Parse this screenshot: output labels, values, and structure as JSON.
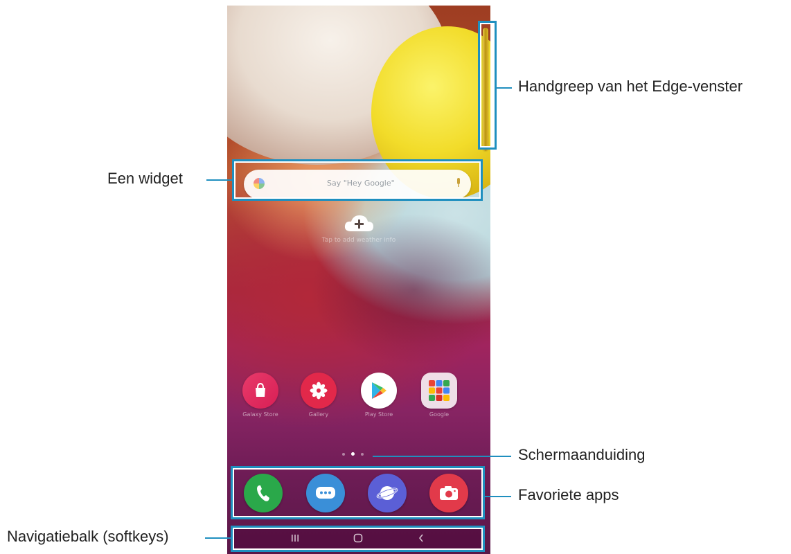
{
  "callouts": {
    "edge_handle": "Handgreep van het Edge-venster",
    "widget": "Een widget",
    "screen_indicator": "Schermaanduiding",
    "favorite_apps": "Favoriete apps",
    "navigation_bar": "Navigatiebalk (softkeys)"
  },
  "screen": {
    "weather_label": "Tap to add weather info",
    "search_placeholder": "Say \"Hey Google\"",
    "apps": [
      {
        "label": "Galaxy Store",
        "icon": "galaxy-store-icon"
      },
      {
        "label": "Gallery",
        "icon": "gallery-icon"
      },
      {
        "label": "Play Store",
        "icon": "play-store-icon"
      },
      {
        "label": "Google",
        "icon": "google-folder-icon"
      }
    ],
    "dock": [
      {
        "icon": "phone-icon"
      },
      {
        "icon": "messages-icon"
      },
      {
        "icon": "internet-icon"
      },
      {
        "icon": "camera-icon"
      }
    ],
    "page_indicator": {
      "pages": 3,
      "active": 2
    },
    "navbar": {
      "recents": "recents-icon",
      "home": "home-icon",
      "back": "back-icon"
    }
  },
  "colors": {
    "highlight": "#1f8fbf",
    "callout_text": "#222222"
  }
}
